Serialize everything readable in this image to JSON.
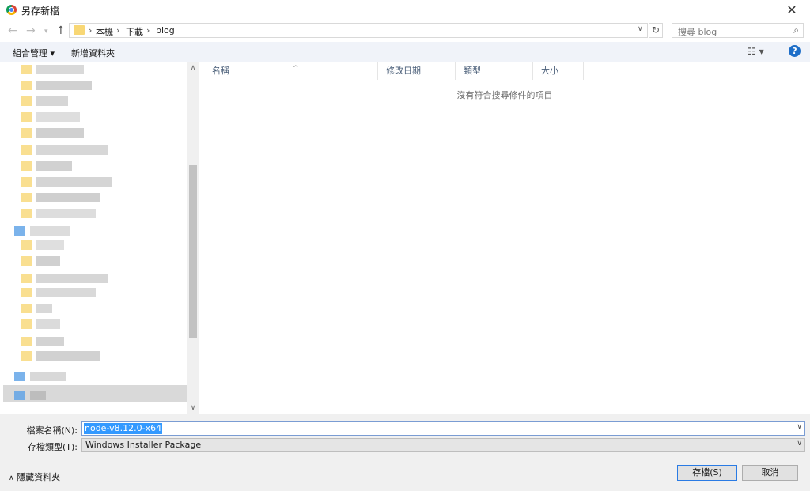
{
  "window": {
    "title": "另存新檔",
    "close_label": "✕"
  },
  "nav": {
    "breadcrumbs": [
      "本機",
      "下載",
      "blog"
    ],
    "search_placeholder": "搜尋 blog"
  },
  "toolbar": {
    "organize_label": "組合管理 ▾",
    "new_folder_label": "新增資料夾"
  },
  "filelist": {
    "columns": [
      "名稱",
      "修改日期",
      "類型",
      "大小"
    ],
    "empty_message": "沒有符合搜尋條件的項目"
  },
  "form": {
    "filename_label": "檔案名稱(N):",
    "filename_value": "node-v8.12.0-x64",
    "filetype_label": "存檔類型(T):",
    "filetype_value": "Windows Installer Package"
  },
  "buttons": {
    "save_label": "存檔(S)",
    "cancel_label": "取消",
    "hide_folders_label": "隱藏資料夾"
  },
  "colors": {
    "accent": "#2a7be4",
    "selection": "#3399ff",
    "command_bar": "#f0f3f9",
    "help": "#1e6ec8"
  },
  "icons": [
    "chrome-icon",
    "back-arrow-icon",
    "forward-arrow-icon",
    "up-arrow-icon",
    "folder-icon",
    "refresh-icon",
    "search-icon",
    "view-options-icon",
    "help-icon",
    "chevron-down-icon",
    "chevron-up-icon"
  ]
}
